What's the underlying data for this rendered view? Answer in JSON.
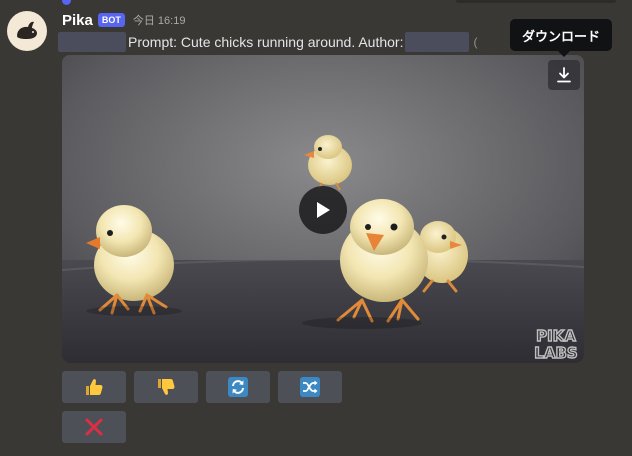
{
  "reply": {
    "text": "",
    "mention": ""
  },
  "message": {
    "username": "Pika",
    "bot_badge": "BOT",
    "timestamp": "今日 16:19",
    "prompt_text": "Prompt: Cute chicks running around.  Author:",
    "trailing": "("
  },
  "video": {
    "watermark_line1": "PIKA",
    "watermark_line2": "LABS",
    "download_tooltip": "ダウンロード"
  },
  "icons": {
    "play": "play-icon",
    "download": "download-icon",
    "thumbs_up": "thumbs-up-icon",
    "thumbs_down": "thumbs-down-icon",
    "repeat": "repeat-icon",
    "shuffle": "shuffle-icon",
    "delete": "x-icon"
  },
  "colors": {
    "background": "#3a3834",
    "bot_badge": "#5865f2",
    "button": "#4e5058",
    "emoji_blue": "#3b88c3",
    "emoji_yellow": "#ffc83d",
    "delete_red": "#dd2e44"
  }
}
